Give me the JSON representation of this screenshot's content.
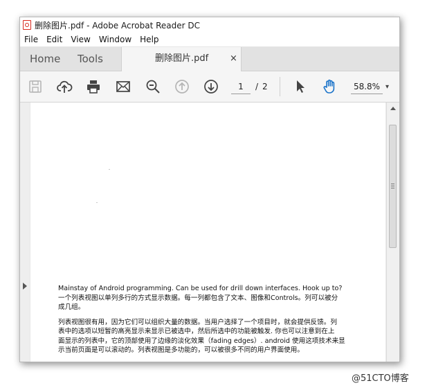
{
  "window": {
    "title": "删除图片.pdf - Adobe Acrobat Reader DC"
  },
  "menu": {
    "items": [
      "File",
      "Edit",
      "View",
      "Window",
      "Help"
    ]
  },
  "tabs": {
    "home": "Home",
    "tools": "Tools",
    "document": "删除图片.pdf",
    "close": "×"
  },
  "toolbar": {
    "icons": [
      "save-icon",
      "upload-icon",
      "print-icon",
      "email-icon",
      "zoom-out-icon",
      "page-up-icon",
      "page-down-icon",
      "select-icon",
      "hand-icon"
    ],
    "page_current": "1",
    "page_separator": "/",
    "page_total": "2",
    "zoom": "58.8%",
    "zoom_arrow": "▾"
  },
  "document": {
    "paragraph1_line1": "Mainstay of Android programming. Can be used for drill down interfaces. Hook up to?",
    "paragraph1_line2": "一个列表视图以单列多行的方式显示数据。每一列都包含了文本、图像和Controls。列可以被分",
    "paragraph1_line3": "成几组。",
    "paragraph2_line1": "列表视图很有用，因为它们可以组织大量的数据。当用户选择了一个项目时，就会提供反馈。列",
    "paragraph2_line2": "表中的选项以短暂的高亮显示来显示已被选中，然后所选中的功能被触发. 你也可以注意到在上",
    "paragraph2_line3": "面显示的列表中，它的顶部使用了边缘的淡化效果（fading edges）. android 使用这项技术来显",
    "paragraph2_line4": "示当前页面是可以滚动的。列表视图是多功能的，可以被很多不同的用户界面使用。"
  },
  "watermark": "@51CTO博客",
  "colors": {
    "accent_blue": "#1a73c9",
    "icon_gray": "#444444",
    "disabled_gray": "#b5b5b5",
    "pdf_red": "#d8261c"
  }
}
